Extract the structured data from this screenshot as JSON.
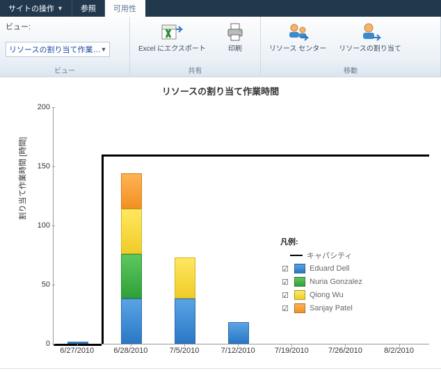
{
  "tabs": {
    "site_actions": "サイトの操作",
    "browse": "参照",
    "availability": "可用性"
  },
  "ribbon": {
    "view_group_label": "ビュー",
    "view_label": "ビュー:",
    "view_dropdown_text": "リソースの割り当て作業…",
    "share_group_label": "共有",
    "export_excel_label": "Excel にエクスポート",
    "print_label": "印刷",
    "move_group_label": "移動",
    "resource_center_label": "リソース センター",
    "resource_assign_label": "リソースの割り当て"
  },
  "chart_title": "リソースの割り当て作業時間",
  "y_axis_label": "割り当て作業時間 [時間]",
  "legend_title": "凡例:",
  "legend_capacity": "キャパシティ",
  "legend_series": [
    {
      "name": "Eduard Dell",
      "color": "blue"
    },
    {
      "name": "Nuria Gonzalez",
      "color": "green"
    },
    {
      "name": "Qiong Wu",
      "color": "yellow"
    },
    {
      "name": "Sanjay Patel",
      "color": "orange"
    }
  ],
  "chart_data": {
    "type": "bar",
    "stacked": true,
    "y_ticks": [
      0,
      50,
      100,
      150,
      200
    ],
    "ylim": [
      0,
      200
    ],
    "categories": [
      "6/27/2010",
      "6/28/2010",
      "7/5/2010",
      "7/12/2010",
      "7/19/2010",
      "7/26/2010",
      "8/2/2010"
    ],
    "series": [
      {
        "name": "Eduard Dell",
        "values": [
          2,
          38,
          38,
          18,
          0,
          0,
          0
        ]
      },
      {
        "name": "Nuria Gonzalez",
        "values": [
          0,
          38,
          0,
          0,
          0,
          0,
          0
        ]
      },
      {
        "name": "Qiong Wu",
        "values": [
          0,
          38,
          35,
          0,
          0,
          0,
          0
        ]
      },
      {
        "name": "Sanjay Patel",
        "values": [
          0,
          30,
          0,
          0,
          0,
          0,
          0
        ]
      }
    ],
    "capacity_line": {
      "name": "キャパシティ",
      "values": [
        0,
        160,
        160,
        160,
        160,
        160,
        160
      ]
    }
  }
}
